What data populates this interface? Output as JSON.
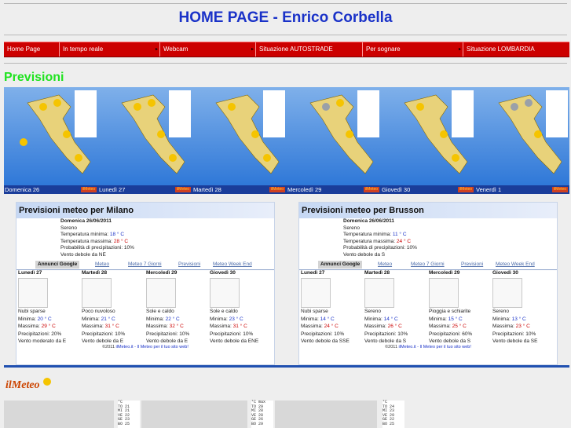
{
  "header": {
    "title": "HOME PAGE - Enrico Corbella"
  },
  "nav": {
    "items": [
      {
        "label": "Home Page",
        "arrow": ""
      },
      {
        "label": "In tempo reale",
        "arrow": "▸"
      },
      {
        "label": "Webcam",
        "arrow": "▸"
      },
      {
        "label": "Situazione AUTOSTRADE",
        "arrow": ""
      },
      {
        "label": "Per sognare",
        "arrow": "▸"
      },
      {
        "label": "Situazione LOMBARDIA",
        "arrow": ""
      }
    ]
  },
  "section": {
    "title": "Previsioni"
  },
  "maps": {
    "days": [
      "Domenica 26",
      "Lunedì 27",
      "Martedì 28",
      "Mercoledì 29",
      "Giovedì 30",
      "Venerdì 1"
    ],
    "logo": "ilMeteo"
  },
  "panels": [
    {
      "title": "Previsioni meteo per Milano",
      "date": "Domenica 26/06/2011",
      "sky": "Sereno",
      "min_label": "Temperatura minima:",
      "min": "18 ° C",
      "max_label": "Temperatura massima:",
      "max": "28 ° C",
      "rain": "Probabilità di precipitazioni: 10%",
      "wind": "Vento debole da NE",
      "tabs": [
        "Annunci Google",
        "Meteo",
        "Meteo 7 Giorni",
        "Previsioni",
        "Meteo Week End"
      ],
      "days": [
        {
          "name": "Lunedì 27",
          "sky": "Nubi sparse",
          "min_label": "Minima:",
          "min": "20 ° C",
          "max_label": "Massima:",
          "max": "29 ° C",
          "rain": "Precipitazioni: 20%",
          "wind": "Vento moderato da E"
        },
        {
          "name": "Martedì 28",
          "sky": "Poco nuvoloso",
          "min_label": "Minima:",
          "min": "21 ° C",
          "max_label": "Massima:",
          "max": "31 ° C",
          "rain": "Precipitazioni: 10%",
          "wind": "Vento debole da E"
        },
        {
          "name": "Mercoledì 29",
          "sky": "Sole e caldo",
          "min_label": "Minima:",
          "min": "22 ° C",
          "max_label": "Massima:",
          "max": "32 ° C",
          "rain": "Precipitazioni: 10%",
          "wind": "Vento debole da E"
        },
        {
          "name": "Giovedì 30",
          "sky": "Sole e caldo",
          "min_label": "Minima:",
          "min": "23 ° C",
          "max_label": "Massima:",
          "max": "31 ° C",
          "rain": "Precipitazioni: 10%",
          "wind": "Vento debole da ENE"
        }
      ],
      "footer_pre": "©2011 ",
      "footer_link": "ilMeteo.it - Il Meteo per il tuo sito web!"
    },
    {
      "title": "Previsioni meteo per Brusson",
      "date": "Domenica 26/06/2011",
      "sky": "Sereno",
      "min_label": "Temperatura minima:",
      "min": "11 ° C",
      "max_label": "Temperatura massima:",
      "max": "24 ° C",
      "rain": "Probabilità di precipitazioni: 10%",
      "wind": "Vento debole da S",
      "tabs": [
        "Annunci Google",
        "Meteo",
        "Meteo 7 Giorni",
        "Previsioni",
        "Meteo Week End"
      ],
      "days": [
        {
          "name": "Lunedì 27",
          "sky": "Nubi sparse",
          "min_label": "Minima:",
          "min": "14 ° C",
          "max_label": "Massima:",
          "max": "24 ° C",
          "rain": "Precipitazioni: 10%",
          "wind": "Vento debole da SSE"
        },
        {
          "name": "Martedì 28",
          "sky": "Sereno",
          "min_label": "Minima:",
          "min": "14 ° C",
          "max_label": "Massima:",
          "max": "26 ° C",
          "rain": "Precipitazioni: 10%",
          "wind": "Vento debole da S"
        },
        {
          "name": "Mercoledì 29",
          "sky": "Pioggia e schiarite",
          "min_label": "Minima:",
          "min": "15 ° C",
          "max_label": "Massima:",
          "max": "25 ° C",
          "rain": "Precipitazioni: 60%",
          "wind": "Vento debole da S"
        },
        {
          "name": "Giovedì 30",
          "sky": "Sereno",
          "min_label": "Minima:",
          "min": "13 ° C",
          "max_label": "Massima:",
          "max": "23 ° C",
          "rain": "Precipitazioni: 10%",
          "wind": "Vento debole da SE"
        }
      ],
      "footer_pre": "©2011 ",
      "footer_link": "ilMeteo.it - Il Meteo per il tuo sito web!"
    }
  ],
  "bottom": {
    "logo": "ilMeteo",
    "scales": [
      {
        "unit": "°C",
        "rows": [
          "TO 21",
          "MI 21",
          "VE 22",
          "GE 23",
          "BO 25"
        ]
      },
      {
        "unit": "°C max",
        "rows": [
          "TO 29",
          "MI 28",
          "VE 28",
          "GE 26",
          "BO 29"
        ]
      },
      {
        "unit": "°C",
        "rows": [
          "TO 24",
          "MI 23",
          "VE 29",
          "GE 22",
          "BO 25"
        ]
      }
    ]
  }
}
